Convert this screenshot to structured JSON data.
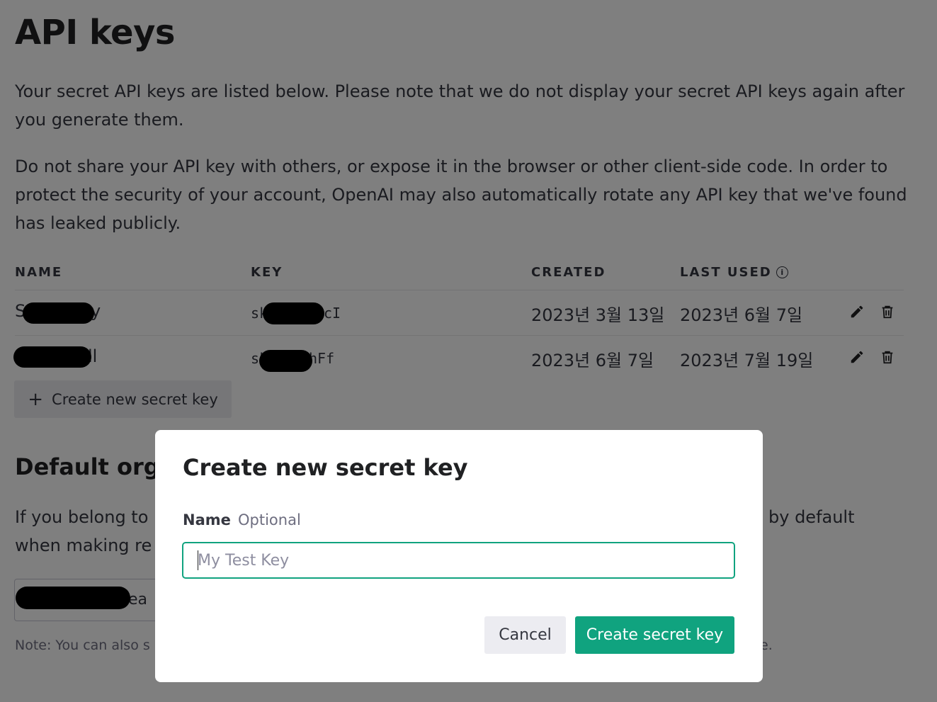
{
  "page": {
    "title": "API keys",
    "intro": "Your secret API keys are listed below. Please note that we do not display your secret API keys again after you generate them.",
    "warning": "Do not share your API key with others, or expose it in the browser or other client-side code. In order to protect the security of your account, OpenAI may also automatically rotate any API key that we've found has leaked publicly."
  },
  "table": {
    "headers": {
      "name": "NAME",
      "key": "KEY",
      "created": "CREATED",
      "last_used": "LAST USED"
    },
    "rows": [
      {
        "name_visible_start": "S",
        "name_visible_end": "y",
        "key_prefix": "sk",
        "key_suffix": "cI",
        "created": "2023년 3월 13일",
        "last_used": "2023년 6월 7일"
      },
      {
        "name_visible_start": "",
        "name_visible_end": "ll",
        "key_prefix": "sk",
        "key_suffix": "hFf",
        "created": "2023년 6월 7일",
        "last_used": "2023년 7월 19일"
      }
    ]
  },
  "create_button": {
    "label": "Create new secret key",
    "icon": "plus-icon"
  },
  "default_org": {
    "heading": "Default organ",
    "description_line1_start": "If you belong to",
    "description_line1_end": "by default",
    "description_line2": "when making re",
    "select_value_visible": "ea",
    "note_start": "Note: You can also s",
    "note_end": "e."
  },
  "modal": {
    "title": "Create new secret key",
    "name_label": "Name",
    "optional_label": "Optional",
    "name_placeholder": "My Test Key",
    "cancel_label": "Cancel",
    "submit_label": "Create secret key",
    "accent_color": "#10a37f"
  },
  "icons": {
    "info": "info-icon",
    "edit": "pencil-icon",
    "delete": "trash-icon"
  }
}
